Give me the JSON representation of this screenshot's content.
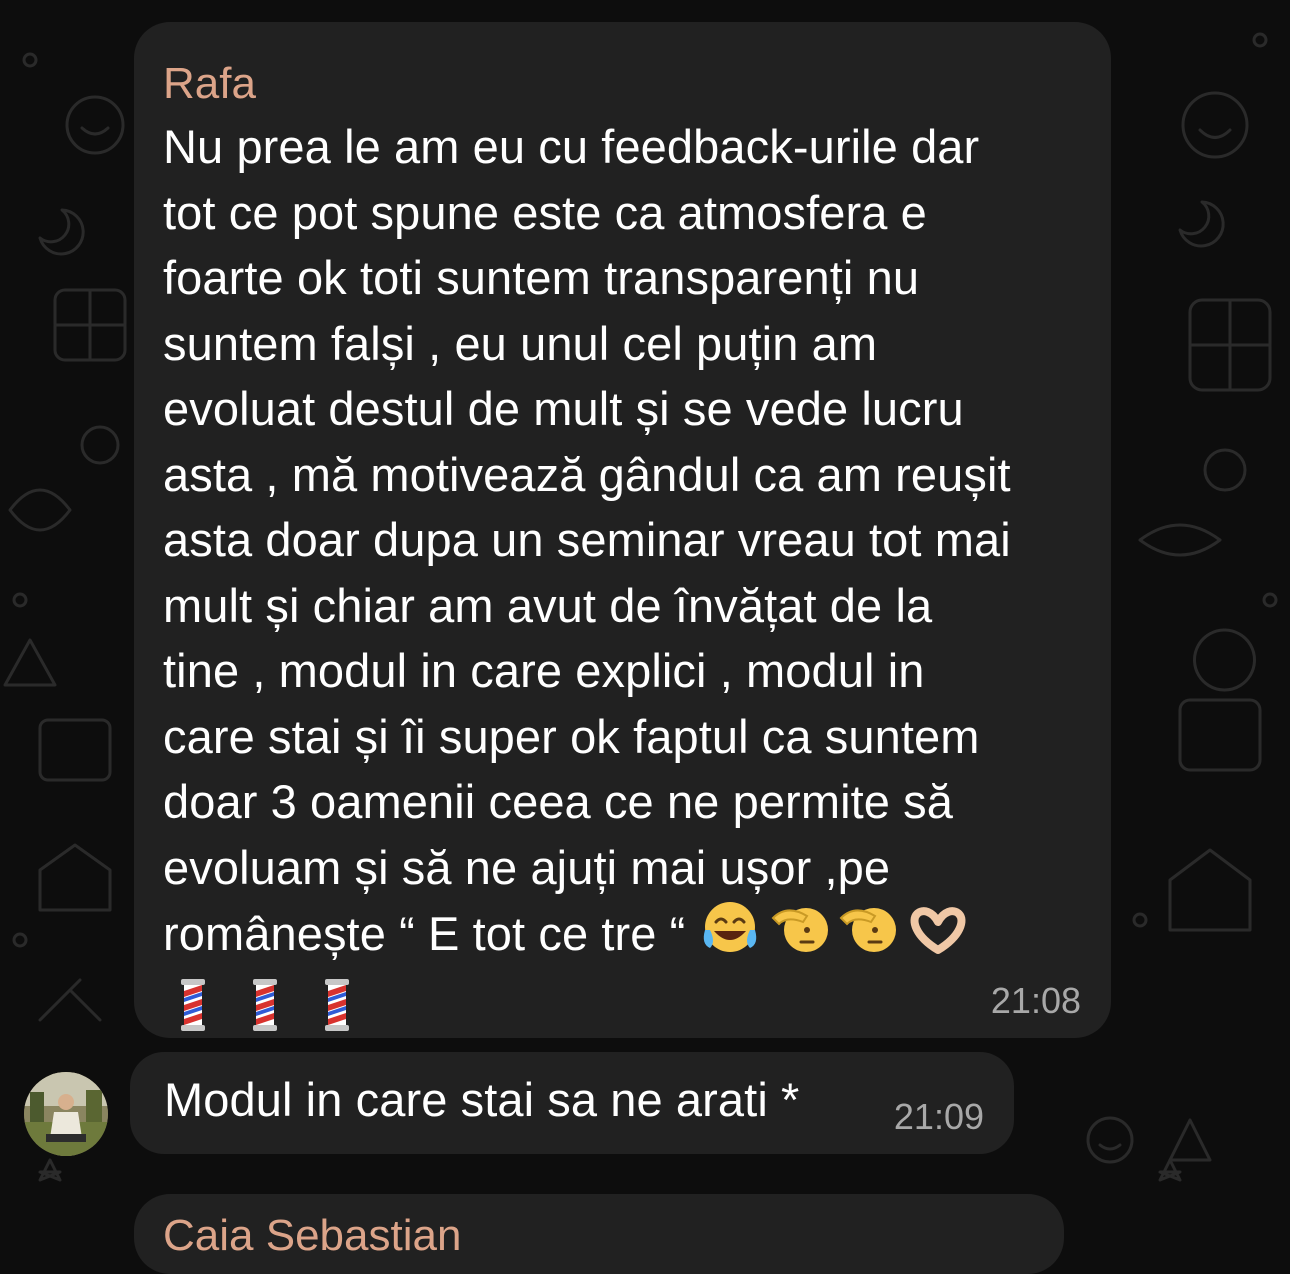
{
  "messages": [
    {
      "sender": "Rafa",
      "text": "Nu prea le am eu cu feedback-urile dar\ntot ce pot spune este ca atmosfera e\nfoarte ok toti suntem transparenți nu\nsuntem falși , eu unul cel puțin am\nevoluat destul de mult și se vede lucru\nasta , mă motivează gândul ca am reușit\nasta doar dupa un seminar vreau tot mai\nmult și chiar am avut de învățat de la\ntine , modul in care explici , modul in\ncare stai și îi super ok faptul ca suntem\ndoar 3 oamenii ceea ce ne permite să\nevoluam și să ne ajuți mai ușor ,pe\nromânește “ E tot ce tre “",
      "inline_emojis": [
        "tears-of-joy",
        "saluting-face",
        "saluting-face",
        "heart-hands"
      ],
      "emoji_row": [
        "barber-pole",
        "barber-pole",
        "barber-pole"
      ],
      "time": "21:08"
    },
    {
      "text": "Modul in care stai sa ne arati *",
      "time": "21:09",
      "avatar": "user-avatar"
    },
    {
      "sender": "Caia Sebastian"
    }
  ],
  "colors": {
    "background": "#0d0d0d",
    "bubble": "#212121",
    "sender_name": "#dca489",
    "time": "#a8a8a8",
    "text": "#ffffff"
  }
}
